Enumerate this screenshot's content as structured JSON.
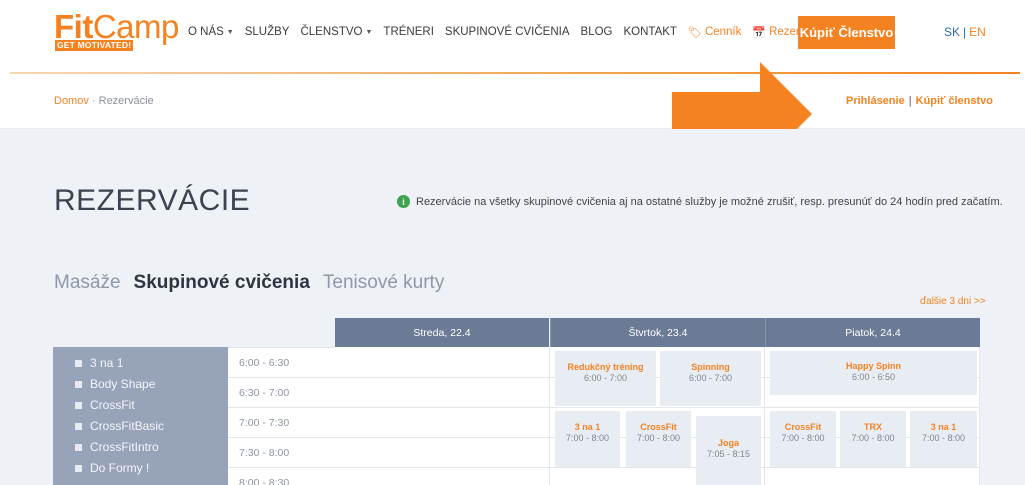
{
  "header": {
    "logo": {
      "brand_fit": "Fit",
      "brand_camp": "Camp",
      "tagline": "GET MOTIVATED!"
    },
    "nav": [
      {
        "label": "O NÁS",
        "caret": true
      },
      {
        "label": "SLUŽBY",
        "caret": false
      },
      {
        "label": "ČLENSTVO",
        "caret": true
      },
      {
        "label": "TRÉNERI",
        "caret": false
      },
      {
        "label": "SKUPINOVÉ CVIČENIA",
        "caret": false
      },
      {
        "label": "BLOG",
        "caret": false
      },
      {
        "label": "KONTAKT",
        "caret": false
      }
    ],
    "pricing_link": "Cenník",
    "reservation_link": "Rezervácie/Rozvrh",
    "buy_button": "Kúpiť Členstvo",
    "lang_sk": "SK",
    "lang_sep": "|",
    "lang_en": "EN"
  },
  "breadcrumb": {
    "home": "Domov",
    "sep": " · ",
    "current": "Rezervácie"
  },
  "account_links": {
    "login": "Prihlásenie",
    "sep": "|",
    "buy": "Kúpiť členstvo"
  },
  "page": {
    "title": "REZERVÁCIE",
    "info": "Rezervácie na všetky skupinové cvičenia aj na ostatné služby je možné zrušiť, resp. presunúť do 24 hodín pred začatím."
  },
  "tabs": [
    "Masáže",
    "Skupinové cvičenia",
    "Tenisové kurty"
  ],
  "active_tab": "Skupinové cvičenia",
  "next_days": "ďalšie 3 dni >>",
  "filters": [
    "3 na 1",
    "Body Shape",
    "CrossFit",
    "CrossFitBasic",
    "CrossFitIntro",
    "Do Formy !"
  ],
  "times": [
    "6:00 - 6:30",
    "6:30 - 7:00",
    "7:00 - 7:30",
    "7:30 - 8:00",
    "8:00 - 8:30"
  ],
  "days": [
    "Streda, 22.4",
    "Štvrtok, 23.4",
    "Piatok, 24.4"
  ],
  "events": [
    {
      "name": "Redukčný tréning",
      "time": "6:00 - 7:00"
    },
    {
      "name": "Spinning",
      "time": "6:00 - 7:00"
    },
    {
      "name": "3 na 1",
      "time": "7:00 - 8:00"
    },
    {
      "name": "CrossFit",
      "time": "7:00 - 8:00"
    },
    {
      "name": "Joga",
      "time": "7:05 - 8:15"
    },
    {
      "name": "Happy Spinn",
      "time": "6:00 - 6:50"
    },
    {
      "name": "CrossFit",
      "time": "7:00 - 8:00"
    },
    {
      "name": "TRX",
      "time": "7:00 - 8:00"
    },
    {
      "name": "3 na 1",
      "time": "7:00 - 8:00"
    }
  ],
  "colors": {
    "accent": "#f58220",
    "header_col": "#6b7a95",
    "filter_bg": "#97a3b8",
    "page_bg": "#eef1f6",
    "info_green": "#3fa34d"
  }
}
